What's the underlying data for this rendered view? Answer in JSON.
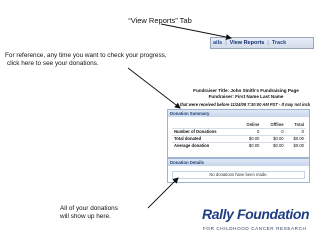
{
  "slide": {
    "title": "“View Reports” Tab",
    "instruction_top_line1": "For reference, any time you want to check your progress,",
    "instruction_top_line2": "click here to see your donations.",
    "instruction_bottom_line1": "All of your donations",
    "instruction_bottom_line2": "will show up here."
  },
  "tabs": {
    "left_partial": "ails",
    "active": "View Reports",
    "right_partial": "Track",
    "separator": "|"
  },
  "report": {
    "title_line1": "Fundraiser Title: John Smith's Fundraising Page",
    "title_line2": "Fundraiser: First Name Last Name",
    "note": "that were received before 11/24/09 7:30:00 AM PST - It may not include",
    "summary": {
      "title": "Donation Summary",
      "columns": [
        "",
        "Online",
        "Offline",
        "Total"
      ],
      "rows": [
        [
          "Number of Donations",
          "0",
          "0",
          "0"
        ],
        [
          "Total donated",
          "$0.00",
          "$0.00",
          "$0.00"
        ],
        [
          "Average donation",
          "$0.00",
          "$0.00",
          "$0.00"
        ]
      ]
    },
    "details": {
      "title": "Donation Details",
      "empty_message": "No donations have been made."
    }
  },
  "logo": {
    "wordmark": "Rally Foundation",
    "tagline": "FOR CHILDHOOD CANCER RESEARCH",
    "colors": {
      "wordmark": "#1f3f84"
    }
  },
  "colors": {
    "arrow": "#111111",
    "tab_text": "#214a8a",
    "panel_border": "#9db3d2"
  }
}
